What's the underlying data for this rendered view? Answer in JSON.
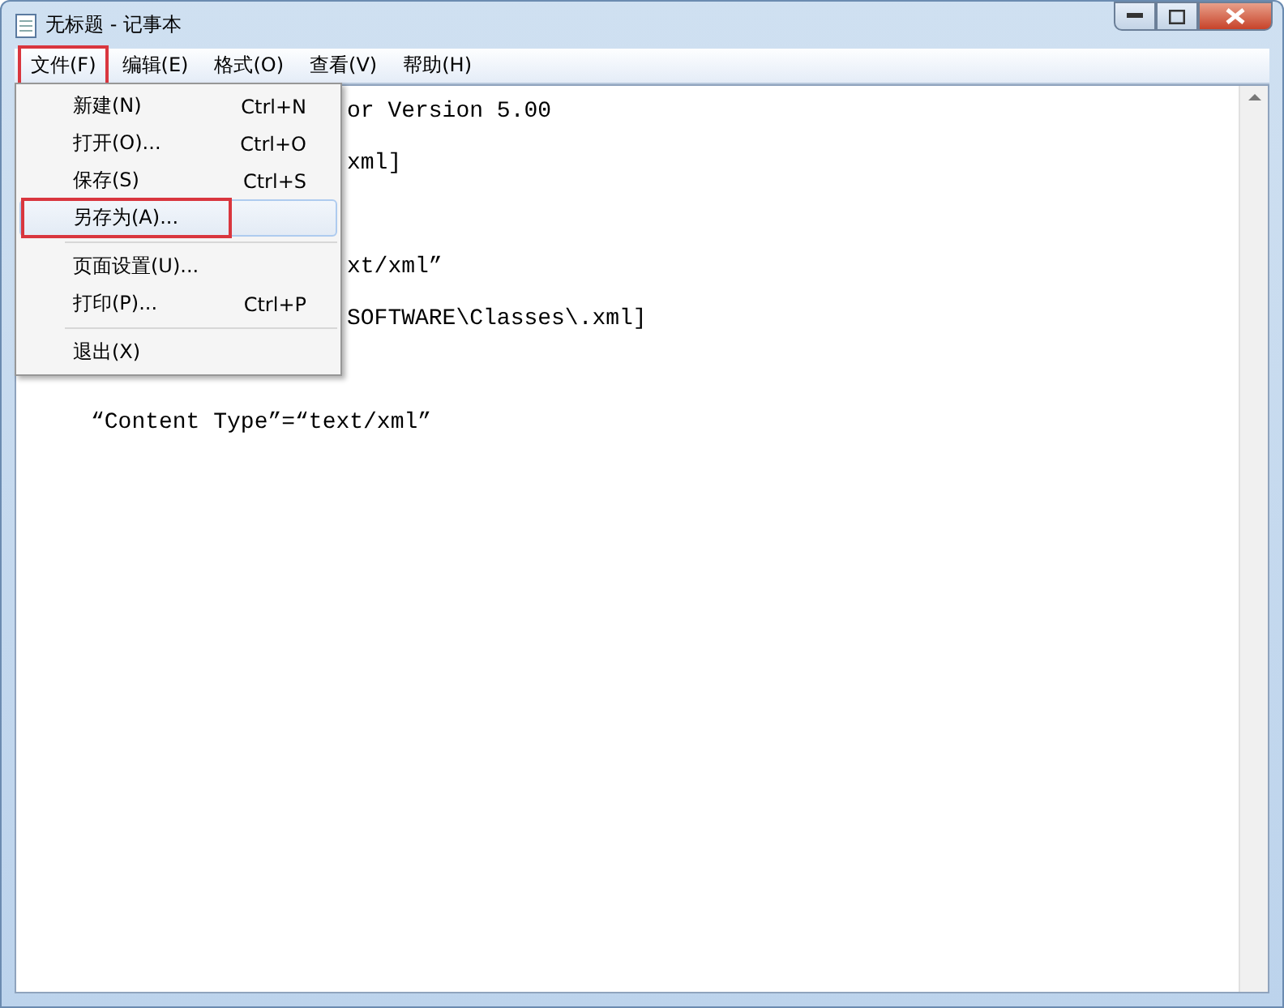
{
  "window": {
    "title": "无标题 - 记事本"
  },
  "menubar": [
    {
      "label": "文件(F)",
      "selected": true
    },
    {
      "label": "编辑(E)",
      "selected": false
    },
    {
      "label": "格式(O)",
      "selected": false
    },
    {
      "label": "查看(V)",
      "selected": false
    },
    {
      "label": "帮助(H)",
      "selected": false
    }
  ],
  "menu": [
    {
      "kind": "item",
      "label": "新建(N)",
      "shortcut": "Ctrl+N",
      "selected": false
    },
    {
      "kind": "item",
      "label": "打开(O)...",
      "shortcut": "Ctrl+O",
      "selected": false
    },
    {
      "kind": "item",
      "label": "保存(S)",
      "shortcut": "Ctrl+S",
      "selected": false
    },
    {
      "kind": "item",
      "label": "另存为(A)...",
      "selected": true
    },
    {
      "kind": "separator"
    },
    {
      "kind": "item",
      "label": "页面设置(U)...",
      "selected": false
    },
    {
      "kind": "item",
      "label": "打印(P)...",
      "shortcut": "Ctrl+P",
      "selected": false
    },
    {
      "kind": "separator"
    },
    {
      "kind": "item",
      "label": "退出(X)",
      "selected": false
    }
  ],
  "editor": {
    "lines": [
      {
        "kind": "covered",
        "text": "or Version 5.00"
      },
      {
        "kind": "covered",
        "text": "xml]"
      },
      {
        "kind": "blank"
      },
      {
        "kind": "covered",
        "text": "xt/xml”"
      },
      {
        "kind": "covered",
        "text": "SOFTWARE\\Classes\\.xml]"
      },
      {
        "kind": "blank"
      },
      {
        "kind": "full",
        "text": "“Content Type”=“text/xml”"
      }
    ]
  }
}
